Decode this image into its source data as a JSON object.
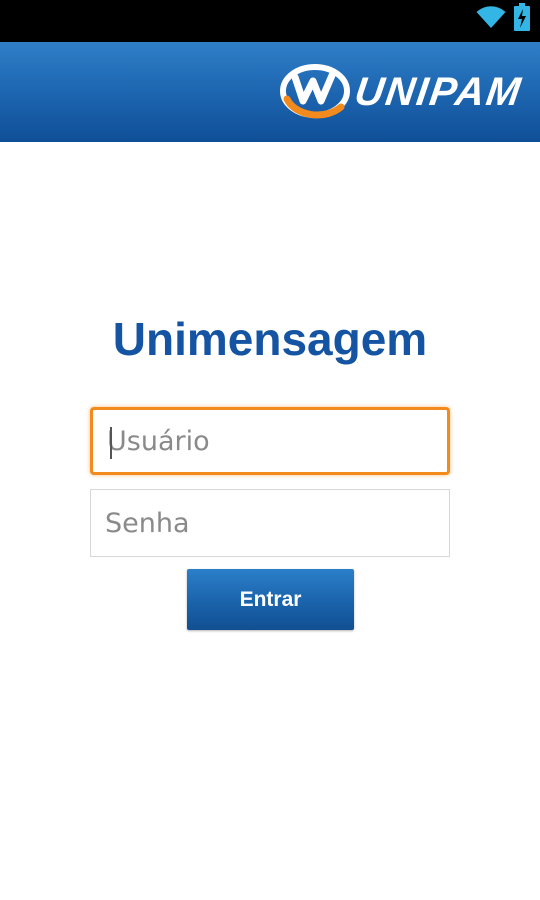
{
  "status_bar": {
    "icons": [
      "wifi-icon",
      "battery-charging-icon"
    ]
  },
  "header": {
    "logo_text": "UNIPAM",
    "logo_icon": "unipam-swirl-logo",
    "gradient_colors": [
      "#2f7fc7",
      "#0f4f97"
    ]
  },
  "login": {
    "title": "Unimensagem",
    "username_placeholder": "Usuário",
    "username_value": "",
    "password_placeholder": "Senha",
    "password_value": "",
    "submit_label": "Entrar"
  },
  "colors": {
    "title": "#1554a3",
    "focus_border": "#f28a1d",
    "button": "#1a63ab"
  }
}
